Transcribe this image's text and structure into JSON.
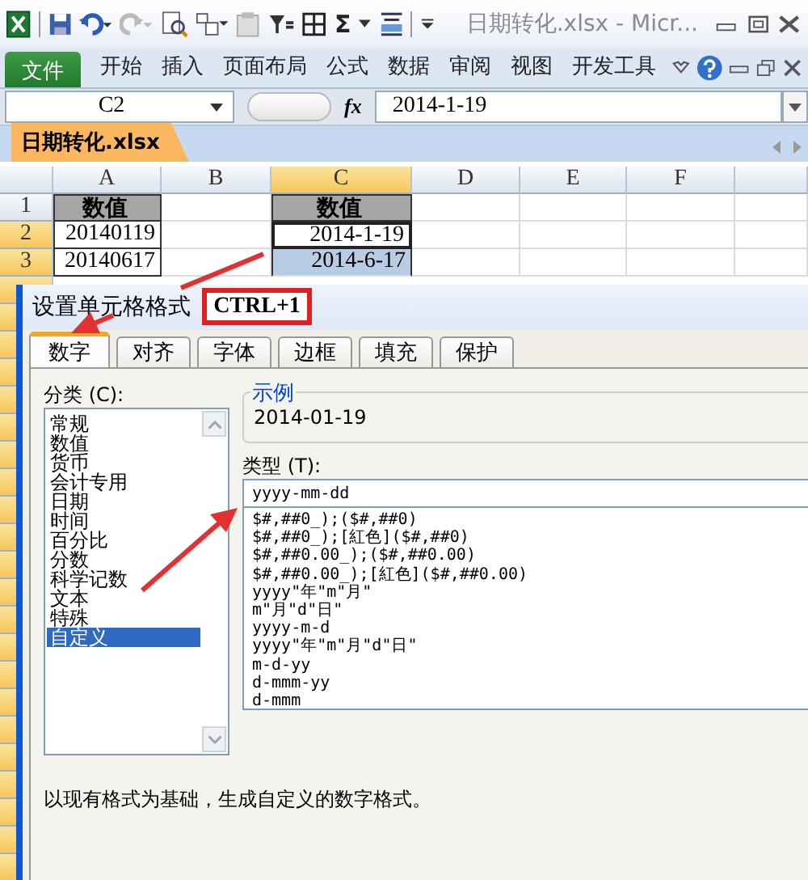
{
  "title_bar": {
    "sum_symbol": "Σ",
    "title": "日期转化.xlsx  -  Micr..."
  },
  "ribbon_tabs": [
    {
      "label": "文件",
      "kind": "file"
    },
    {
      "label": "开始",
      "kind": "tab"
    },
    {
      "label": "插入",
      "kind": "tab"
    },
    {
      "label": "页面布局",
      "kind": "tab"
    },
    {
      "label": "公式",
      "kind": "tab"
    },
    {
      "label": "数据",
      "kind": "tab"
    },
    {
      "label": "审阅",
      "kind": "tab"
    },
    {
      "label": "视图",
      "kind": "tab"
    },
    {
      "label": "开发工具",
      "kind": "tab"
    }
  ],
  "formula_bar": {
    "name_box": "C2",
    "function_label": "fx",
    "formula": "2014-1-19"
  },
  "workbook_tab": {
    "label": "日期转化.xlsx"
  },
  "sheet": {
    "columns": [
      {
        "label": "A",
        "selected": false
      },
      {
        "label": "B",
        "selected": false
      },
      {
        "label": "C",
        "selected": true
      },
      {
        "label": "D",
        "selected": false
      },
      {
        "label": "E",
        "selected": false
      },
      {
        "label": "F",
        "selected": false
      }
    ],
    "rows": [
      {
        "label": "1",
        "selected": false,
        "cell_a": {
          "value": "数值",
          "kind": "header"
        },
        "cell_c": {
          "value": "数值",
          "kind": "header"
        }
      },
      {
        "label": "2",
        "selected": true,
        "cell_a": {
          "value": "20140119",
          "kind": "plain"
        },
        "cell_c": {
          "value": "2014-1-19",
          "kind": "active"
        }
      },
      {
        "label": "3",
        "selected": true,
        "cell_a": {
          "value": "20140617",
          "kind": "plain"
        },
        "cell_c": {
          "value": "2014-6-17",
          "kind": "selected"
        }
      }
    ]
  },
  "dialog": {
    "title": "设置单元格格式",
    "tabs": [
      {
        "label": "数字",
        "selected": true
      },
      {
        "label": "对齐",
        "selected": false
      },
      {
        "label": "字体",
        "selected": false
      },
      {
        "label": "边框",
        "selected": false
      },
      {
        "label": "填充",
        "selected": false
      },
      {
        "label": "保护",
        "selected": false
      }
    ],
    "category_label": "分类 (C):",
    "categories": [
      {
        "label": "常规",
        "selected": false
      },
      {
        "label": "数值",
        "selected": false
      },
      {
        "label": "货币",
        "selected": false
      },
      {
        "label": "会计专用",
        "selected": false
      },
      {
        "label": "日期",
        "selected": false
      },
      {
        "label": "时间",
        "selected": false
      },
      {
        "label": "百分比",
        "selected": false
      },
      {
        "label": "分数",
        "selected": false
      },
      {
        "label": "科学记数",
        "selected": false
      },
      {
        "label": "文本",
        "selected": false
      },
      {
        "label": "特殊",
        "selected": false
      },
      {
        "label": "自定义",
        "selected": true
      }
    ],
    "sample": {
      "legend": "示例",
      "value": "2014-01-19"
    },
    "type_label": "类型 (T):",
    "type_value": "yyyy-mm-dd",
    "formats": [
      "$#,##0_);($#,##0)",
      "$#,##0_);[紅色]($#,##0)",
      "$#,##0.00_);($#,##0.00)",
      "$#,##0.00_);[紅色]($#,##0.00)",
      "yyyy\"年\"m\"月\"",
      "m\"月\"d\"日\"",
      "yyyy-m-d",
      "yyyy\"年\"m\"月\"d\"日\"",
      "m-d-yy",
      "d-mmm-yy",
      "d-mmm"
    ],
    "description": "以现有格式为基础，生成自定义的数字格式。"
  },
  "callout": "CTRL+1"
}
